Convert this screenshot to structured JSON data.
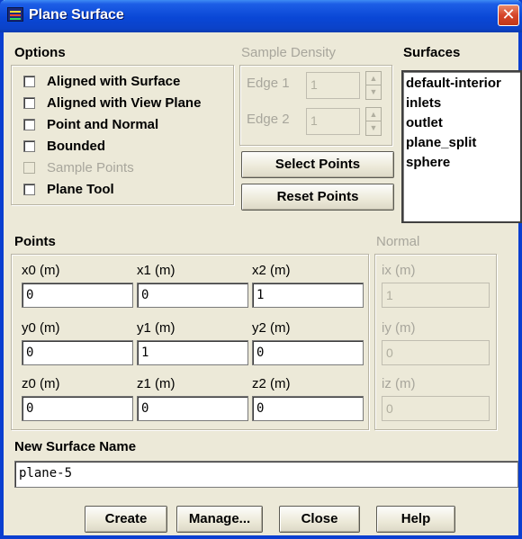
{
  "window": {
    "title": "Plane Surface",
    "close_glyph": "✕"
  },
  "options": {
    "label": "Options",
    "items": [
      {
        "label": "Aligned with Surface",
        "checked": false,
        "enabled": true
      },
      {
        "label": "Aligned with View Plane",
        "checked": false,
        "enabled": true
      },
      {
        "label": "Point and Normal",
        "checked": false,
        "enabled": true
      },
      {
        "label": "Bounded",
        "checked": false,
        "enabled": true
      },
      {
        "label": "Sample Points",
        "checked": false,
        "enabled": false
      },
      {
        "label": "Plane Tool",
        "checked": false,
        "enabled": true
      }
    ]
  },
  "sample_density": {
    "label": "Sample Density",
    "edge1": {
      "label": "Edge 1",
      "value": "1"
    },
    "edge2": {
      "label": "Edge 2",
      "value": "1"
    }
  },
  "buttons": {
    "select_points": "Select Points",
    "reset_points": "Reset Points",
    "create": "Create",
    "manage": "Manage...",
    "close": "Close",
    "help": "Help"
  },
  "surfaces": {
    "label": "Surfaces",
    "items": [
      "default-interior",
      "inlets",
      "outlet",
      "plane_split",
      "sphere"
    ]
  },
  "points": {
    "label": "Points",
    "x0": {
      "label": "x0 (m)",
      "value": "0"
    },
    "x1": {
      "label": "x1 (m)",
      "value": "0"
    },
    "x2": {
      "label": "x2 (m)",
      "value": "1"
    },
    "y0": {
      "label": "y0 (m)",
      "value": "0"
    },
    "y1": {
      "label": "y1 (m)",
      "value": "1"
    },
    "y2": {
      "label": "y2 (m)",
      "value": "0"
    },
    "z0": {
      "label": "z0 (m)",
      "value": "0"
    },
    "z1": {
      "label": "z1 (m)",
      "value": "0"
    },
    "z2": {
      "label": "z2 (m)",
      "value": "0"
    }
  },
  "normal": {
    "label": "Normal",
    "ix": {
      "label": "ix (m)",
      "value": "1"
    },
    "iy": {
      "label": "iy (m)",
      "value": "0"
    },
    "iz": {
      "label": "iz (m)",
      "value": "0"
    }
  },
  "new_surface": {
    "label": "New Surface Name",
    "value": "plane-5"
  },
  "colors": {
    "titlebar": "#0a47d6",
    "close_button": "#d6452a",
    "dialog_bg": "#ece9d8"
  }
}
